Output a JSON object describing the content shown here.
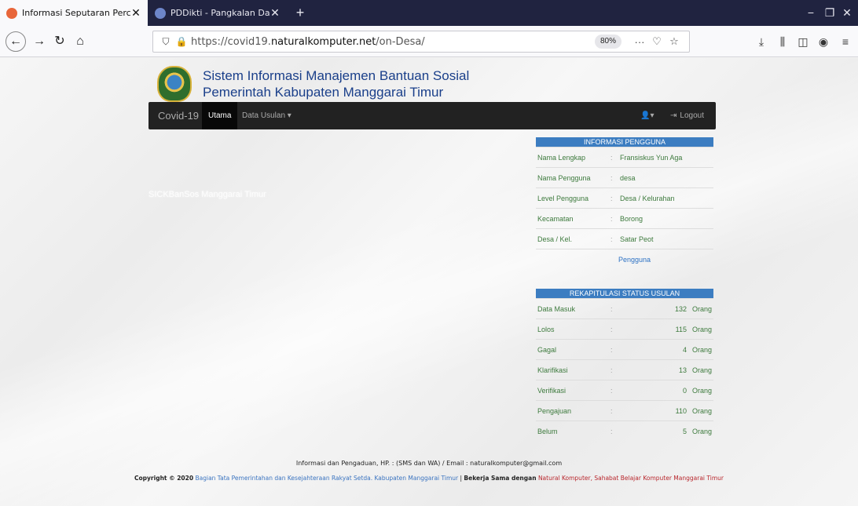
{
  "browser": {
    "tabs": [
      {
        "title": "Informasi Seputaran Percepatan",
        "close": "✕",
        "favicon_color": "#e8663a"
      },
      {
        "title": "PDDikti - Pangkalan Data Pendidikan",
        "close": "✕",
        "favicon_color": "#6d86c9"
      }
    ],
    "new_tab": "+",
    "url_scheme": "https://covid19.",
    "url_host": "naturalkomputer.net",
    "url_path": "/on-Desa/",
    "zoom": "80%",
    "window_controls": {
      "minimize": "−",
      "restore": "❐",
      "close": "✕"
    }
  },
  "header": {
    "title_line1": "Sistem Informasi Manajemen Bantuan Sosial",
    "title_line2": "Pemerintah Kabupaten Manggarai Timur"
  },
  "nav": {
    "brand": "Covid-19",
    "items": [
      {
        "label": "Utama"
      },
      {
        "label": "Data Usulan ▾"
      }
    ],
    "user_icon": "👤▾",
    "logout": "Logout"
  },
  "watermark": "SICKBanSos Manggarai Timur",
  "user_info": {
    "heading": "INFORMASI PENGGUNA",
    "rows": [
      {
        "label": "Nama Lengkap",
        "value": "Fransiskus Yun Aga"
      },
      {
        "label": "Nama Pengguna",
        "value": "desa"
      },
      {
        "label": "Level Pengguna",
        "value": "Desa / Kelurahan"
      },
      {
        "label": "Kecamatan",
        "value": "Borong"
      },
      {
        "label": "Desa / Kel.",
        "value": "Satar Peot"
      }
    ],
    "link": "Pengguna"
  },
  "recap": {
    "heading": "REKAPITULASI STATUS USULAN",
    "unit": "Orang",
    "rows": [
      {
        "label": "Data Masuk",
        "count": "132"
      },
      {
        "label": "Lolos",
        "count": "115"
      },
      {
        "label": "Gagal",
        "count": "4"
      },
      {
        "label": "Klarifikasi",
        "count": "13"
      },
      {
        "label": "Verifikasi",
        "count": "0"
      },
      {
        "label": "Pengajuan",
        "count": "110"
      },
      {
        "label": "Belum",
        "count": "5"
      }
    ]
  },
  "footer": {
    "contact": "Informasi dan Pengaduan, HP. : (SMS dan WA) / Email : naturalkomputer@gmail.com",
    "copyright": "Copyright © 2020",
    "org": "Bagian Tata Pemerintahan dan Kesejahteraan Rakyat Setda. Kabupaten Manggarai Timur",
    "sep": " | ",
    "partner_label": "Bekerja Sama dengan",
    "partner": "Natural Komputer, Sahabat Belajar Komputer Manggarai Timur"
  }
}
